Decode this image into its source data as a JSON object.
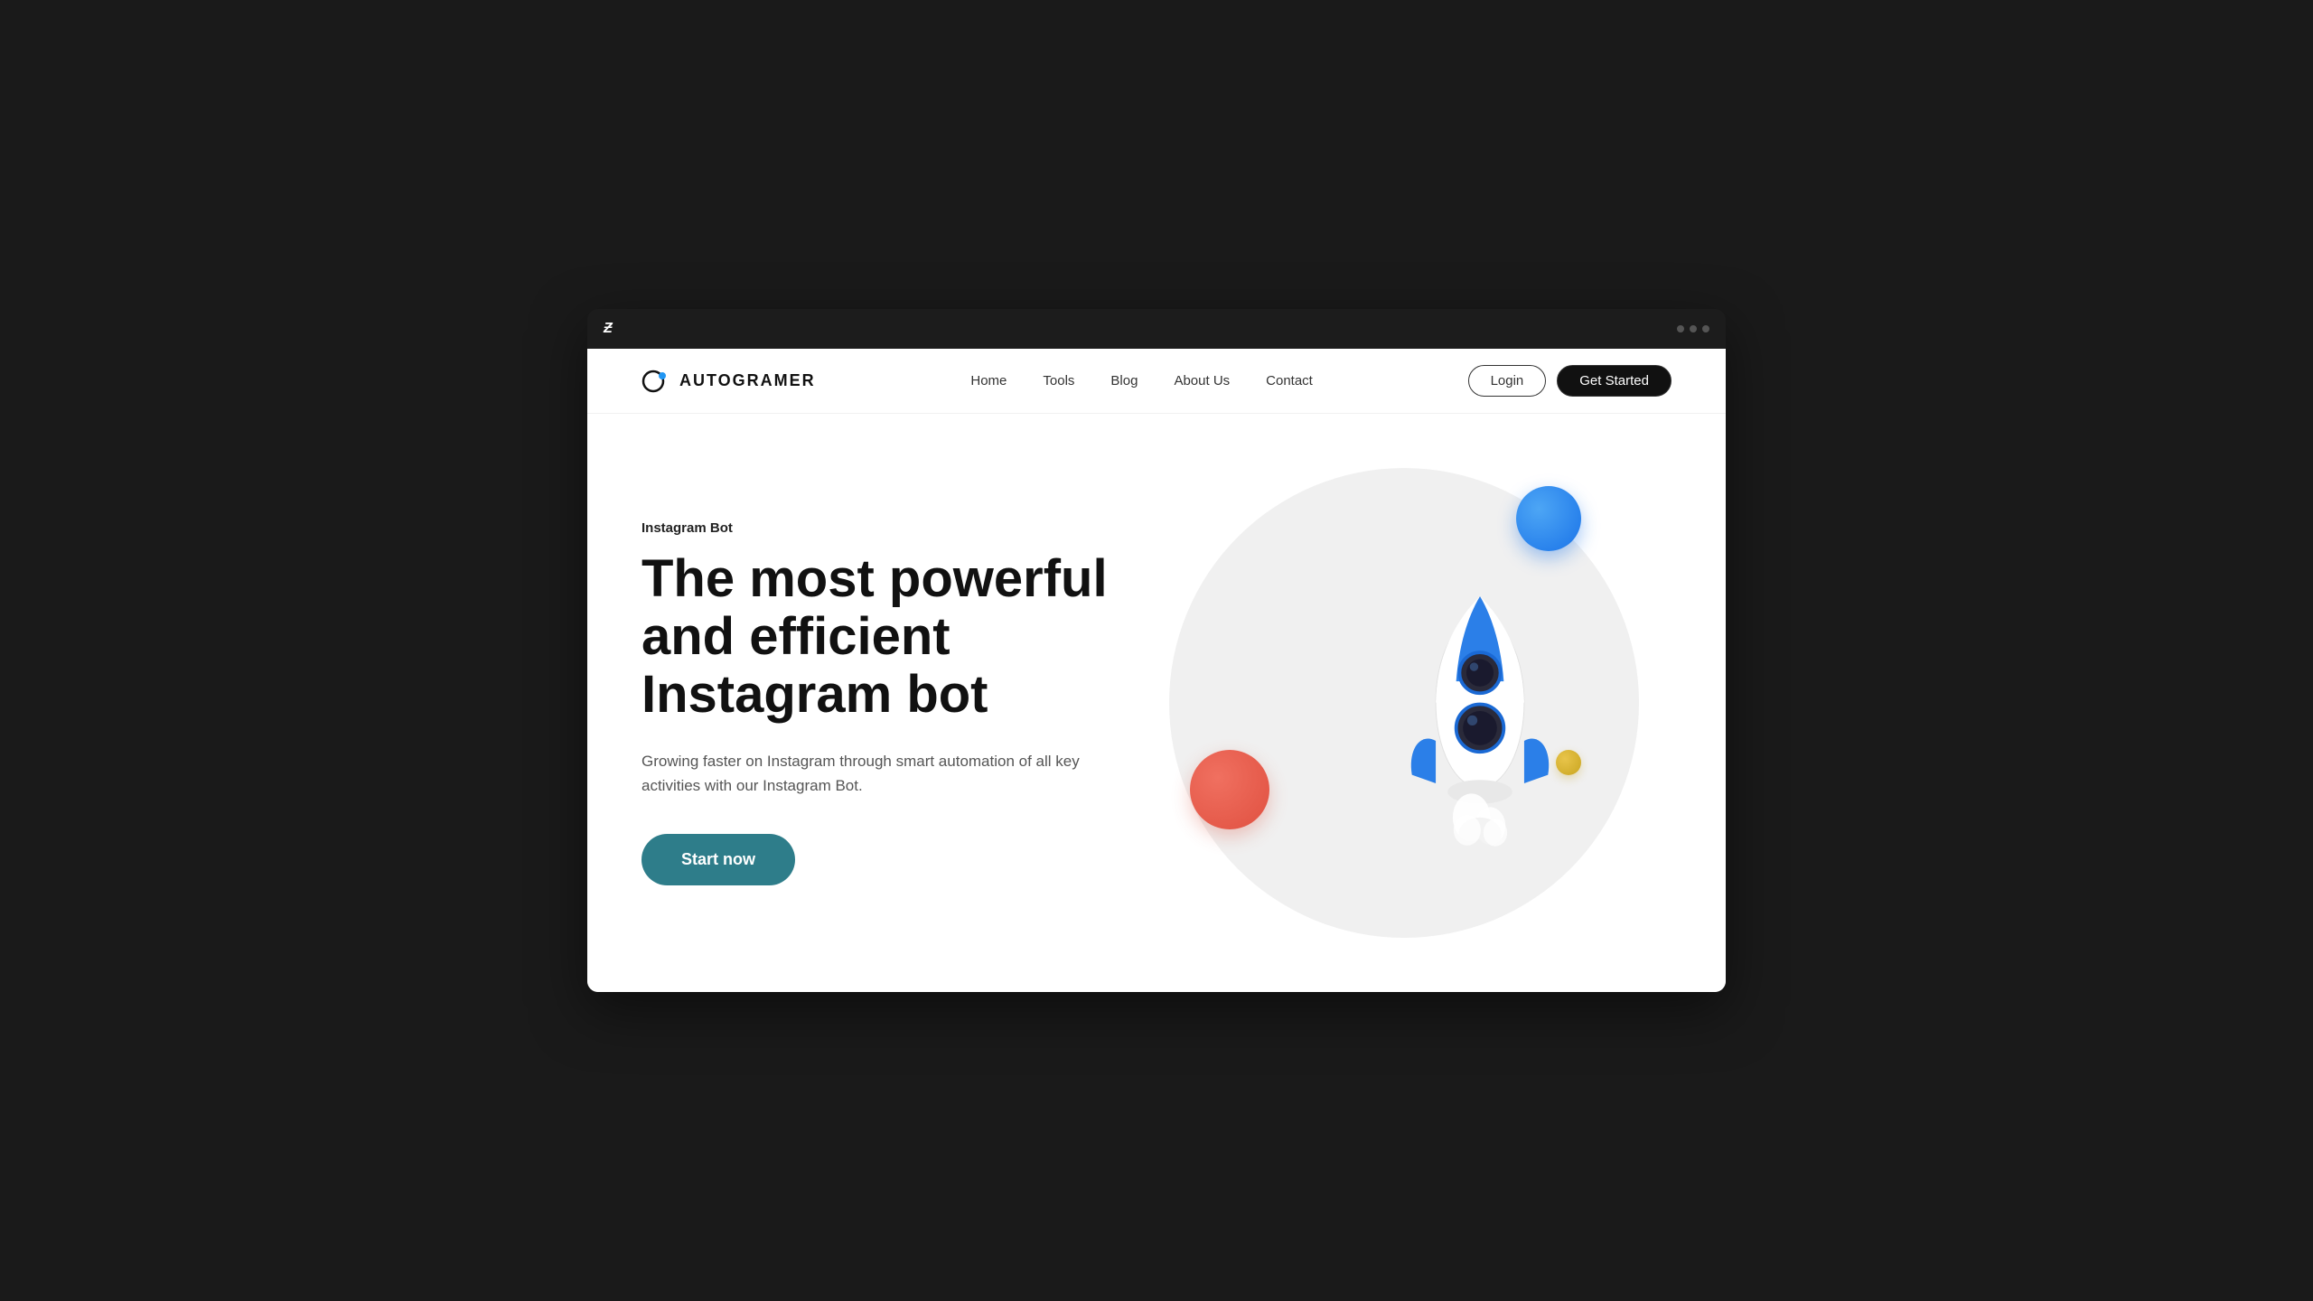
{
  "browser": {
    "logo": "Ƶ",
    "dots": [
      "dot1",
      "dot2",
      "dot3"
    ]
  },
  "navbar": {
    "logo_text": "AUTOGRAMER",
    "links": [
      {
        "label": "Home",
        "id": "home"
      },
      {
        "label": "Tools",
        "id": "tools"
      },
      {
        "label": "Blog",
        "id": "blog"
      },
      {
        "label": "About Us",
        "id": "about"
      },
      {
        "label": "Contact",
        "id": "contact"
      }
    ],
    "login_label": "Login",
    "get_started_label": "Get Started"
  },
  "hero": {
    "subtitle": "Instagram Bot",
    "title": "The most powerful and efficient Instagram bot",
    "description": "Growing faster on Instagram through smart automation of all key activities with our Instagram Bot.",
    "cta_label": "Start now"
  }
}
